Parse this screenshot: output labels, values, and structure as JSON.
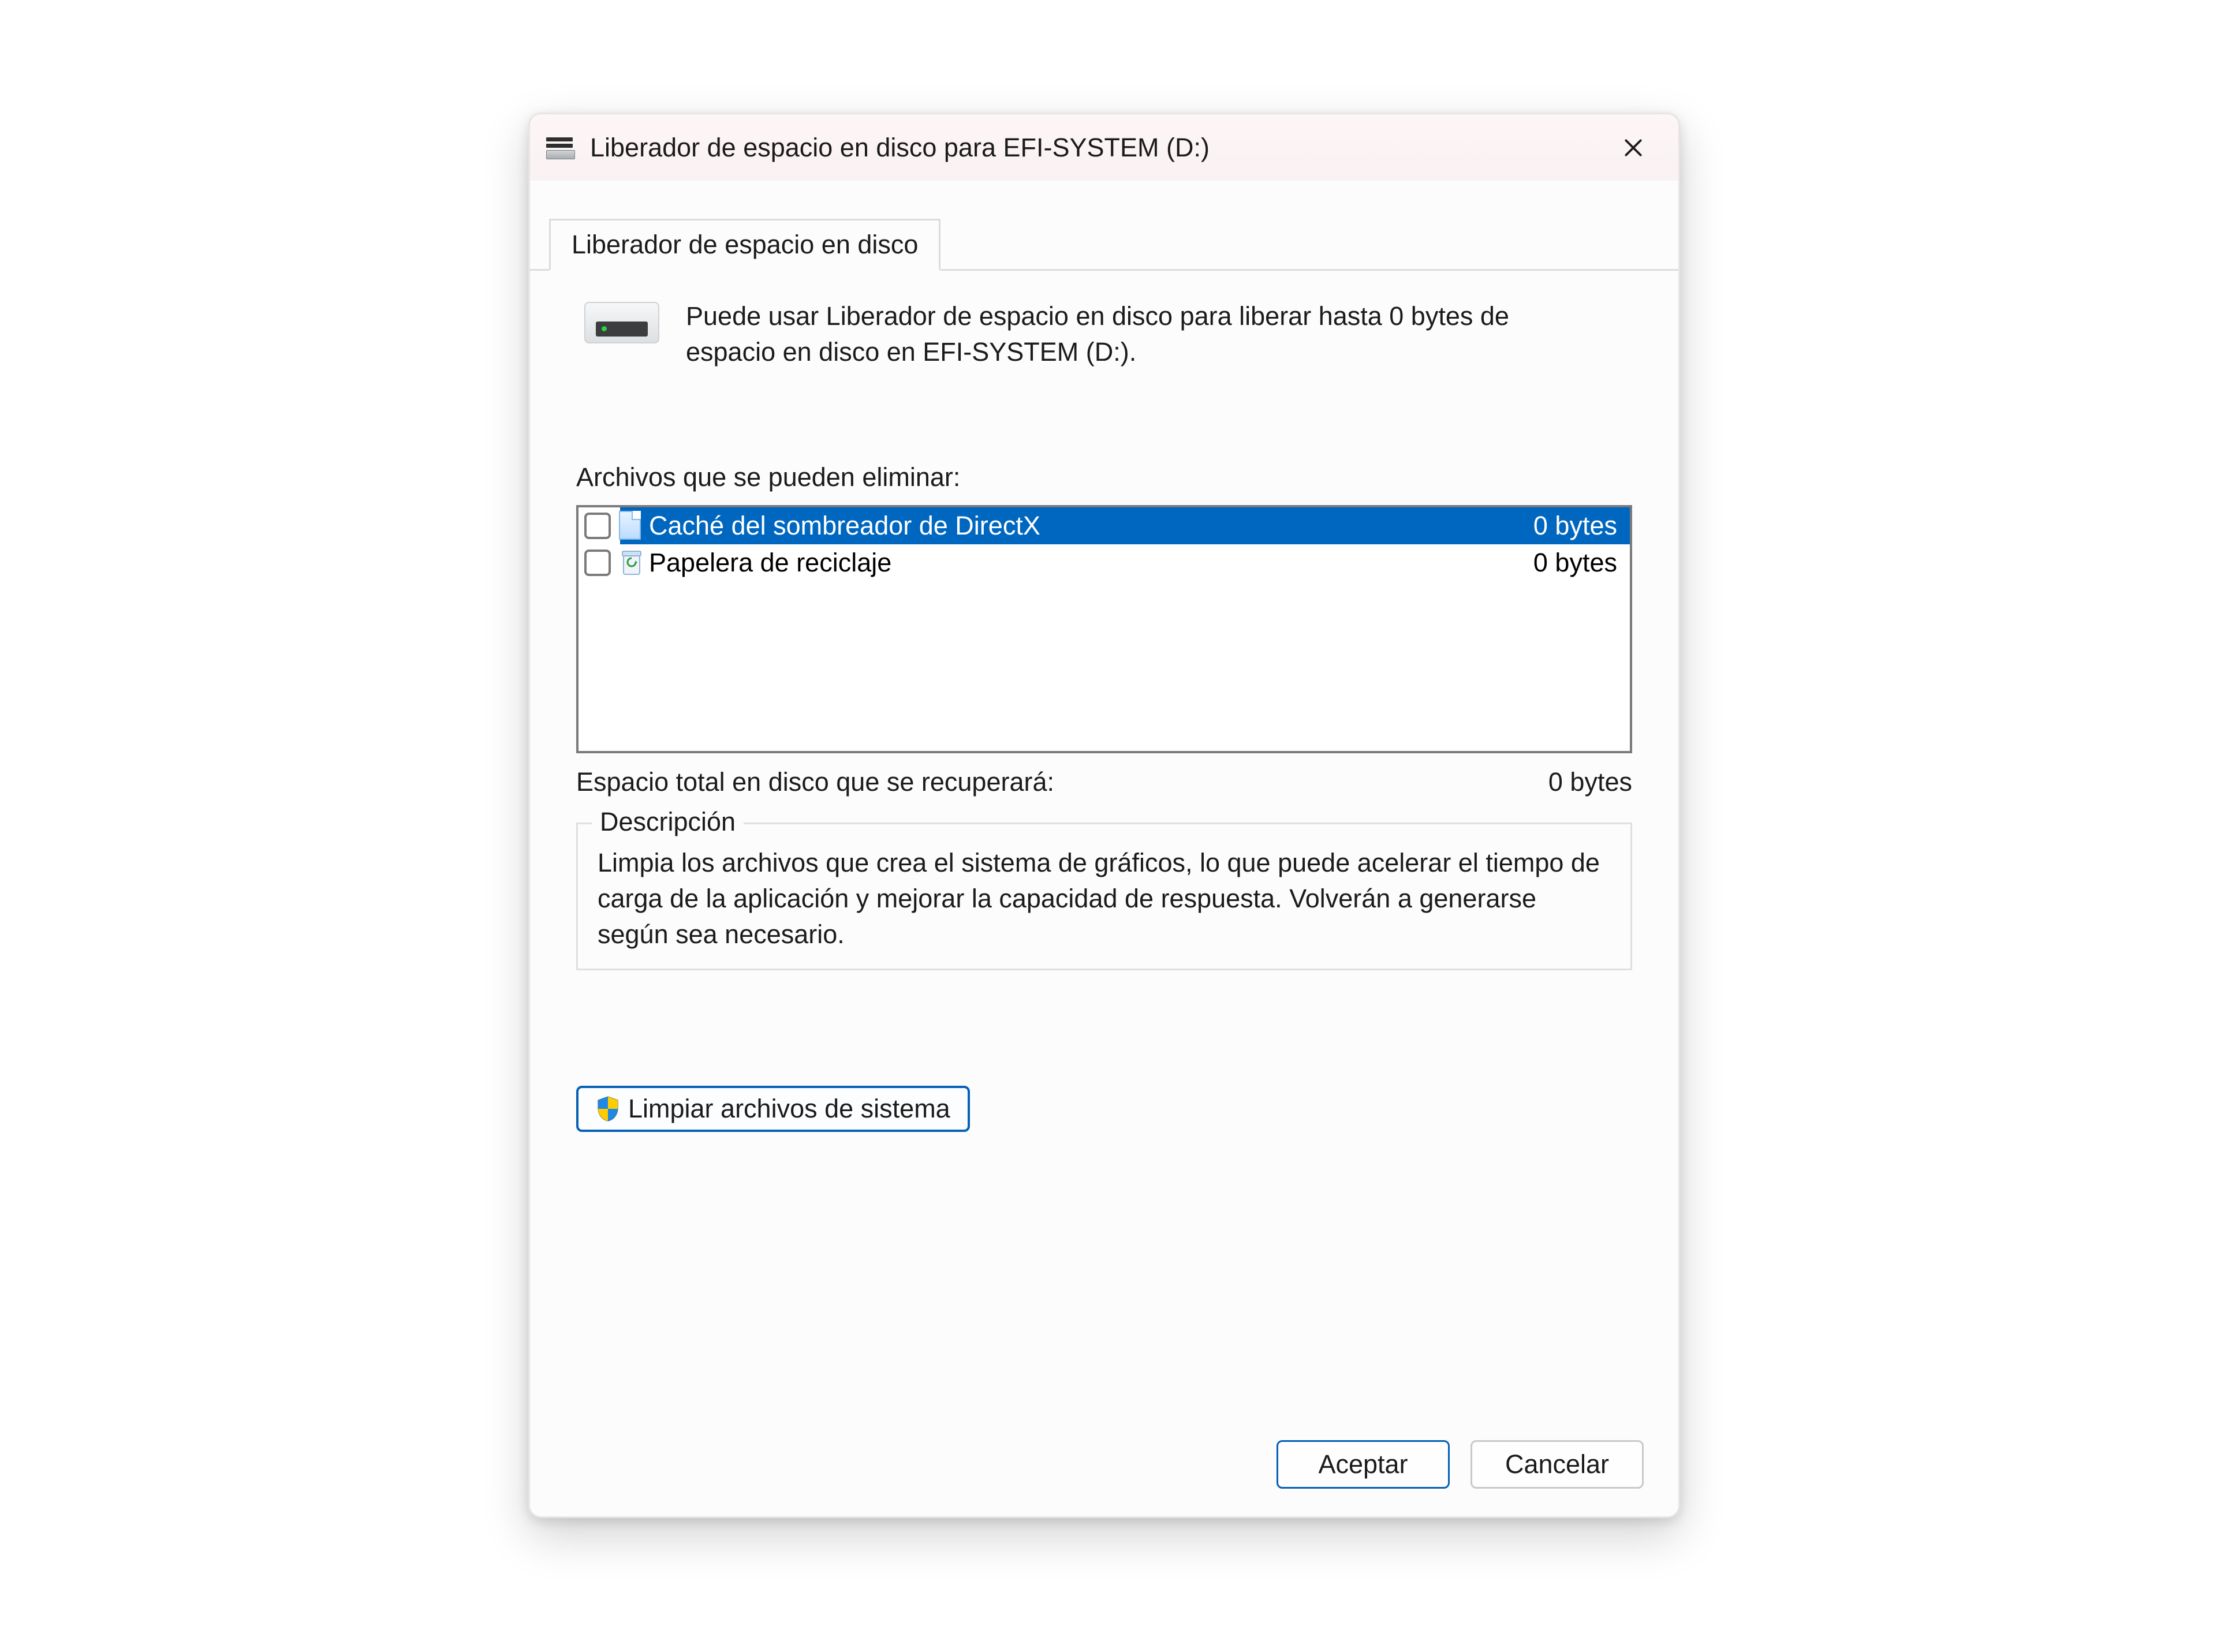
{
  "window": {
    "title": "Liberador de espacio en disco para EFI-SYSTEM (D:)"
  },
  "tab": {
    "label": "Liberador de espacio en disco"
  },
  "intro": {
    "text": "Puede usar Liberador de espacio en disco para liberar hasta 0 bytes de espacio en disco en EFI-SYSTEM (D:)."
  },
  "files": {
    "label": "Archivos que se pueden eliminar:",
    "items": [
      {
        "name": "Caché del sombreador de DirectX",
        "size": "0 bytes",
        "selected": true,
        "checked": false,
        "icon": "page"
      },
      {
        "name": "Papelera de reciclaje",
        "size": "0 bytes",
        "selected": false,
        "checked": false,
        "icon": "bin"
      }
    ]
  },
  "total": {
    "label": "Espacio total en disco que se recuperará:",
    "value": "0 bytes"
  },
  "description": {
    "legend": "Descripción",
    "text": "Limpia los archivos que crea el sistema de gráficos, lo que puede acelerar el tiempo de carga de la aplicación y mejorar la capacidad de respuesta. Volverán a generarse según sea necesario."
  },
  "buttons": {
    "sysclean": "Limpiar archivos de sistema",
    "ok": "Aceptar",
    "cancel": "Cancelar"
  }
}
